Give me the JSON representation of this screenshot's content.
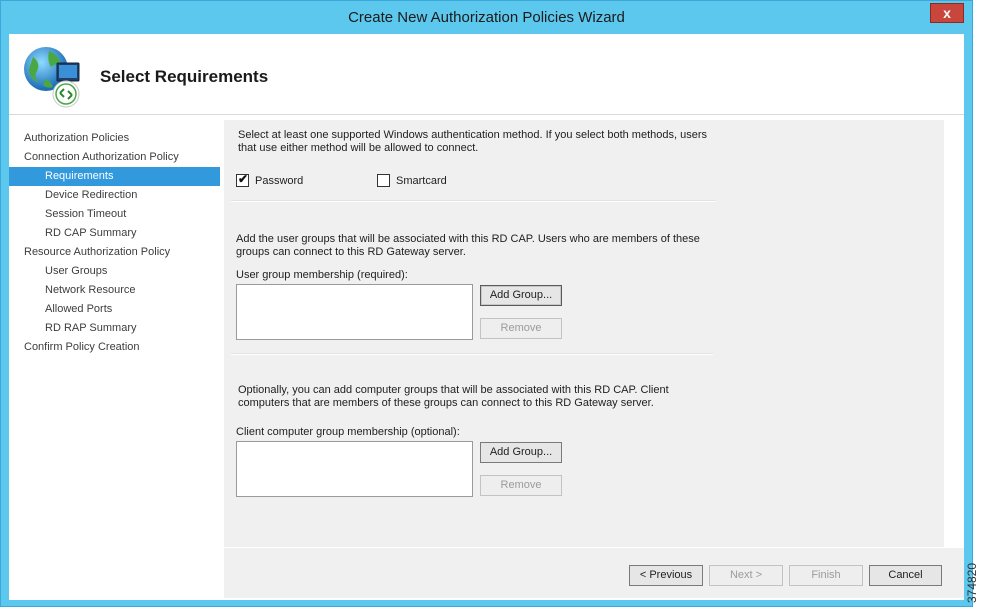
{
  "window": {
    "title": "Create New Authorization Policies Wizard",
    "close_label": "x"
  },
  "header": {
    "title": "Select Requirements",
    "logo_icon": "rd-gateway-globe-icon"
  },
  "sidebar": {
    "items": [
      {
        "label": "Authorization Policies",
        "level": 1,
        "selected": false
      },
      {
        "label": "Connection Authorization Policy",
        "level": 1,
        "selected": false
      },
      {
        "label": "Requirements",
        "level": 2,
        "selected": true
      },
      {
        "label": "Device Redirection",
        "level": 2,
        "selected": false
      },
      {
        "label": "Session Timeout",
        "level": 2,
        "selected": false
      },
      {
        "label": "RD CAP Summary",
        "level": 2,
        "selected": false
      },
      {
        "label": "Resource Authorization Policy",
        "level": 1,
        "selected": false
      },
      {
        "label": "User Groups",
        "level": 2,
        "selected": false
      },
      {
        "label": "Network Resource",
        "level": 2,
        "selected": false
      },
      {
        "label": "Allowed Ports",
        "level": 2,
        "selected": false
      },
      {
        "label": "RD RAP Summary",
        "level": 2,
        "selected": false
      },
      {
        "label": "Confirm Policy Creation",
        "level": 1,
        "selected": false
      }
    ]
  },
  "auth": {
    "intro_line1": "Select at least one supported Windows authentication method. If you select both methods, users",
    "intro_line2": "that use either method will be allowed to connect.",
    "password_label": "Password",
    "password_checked": true,
    "smartcard_label": "Smartcard",
    "smartcard_checked": false
  },
  "user_groups": {
    "intro_line1": "Add the user groups that will be associated with this RD CAP. Users who are members of these",
    "intro_line2": "groups can connect to this RD Gateway server.",
    "list_label": "User group membership (required):",
    "items": [],
    "add_label": "Add Group...",
    "remove_label": "Remove"
  },
  "computer_groups": {
    "intro_line1": "Optionally, you can add computer groups that will be associated with this RD CAP. Client",
    "intro_line2": "computers that are members of these groups can connect to this RD Gateway server.",
    "list_label": "Client computer group membership (optional):",
    "items": [],
    "add_label": "Add Group...",
    "remove_label": "Remove"
  },
  "footer": {
    "previous_label": "< Previous",
    "next_label": "Next >",
    "finish_label": "Finish",
    "cancel_label": "Cancel"
  },
  "figure_id": "374820",
  "colors": {
    "title_bar": "#5cc8ee",
    "selection": "#3399dd",
    "close_button": "#c9463d",
    "panel": "#f0f0f0"
  }
}
